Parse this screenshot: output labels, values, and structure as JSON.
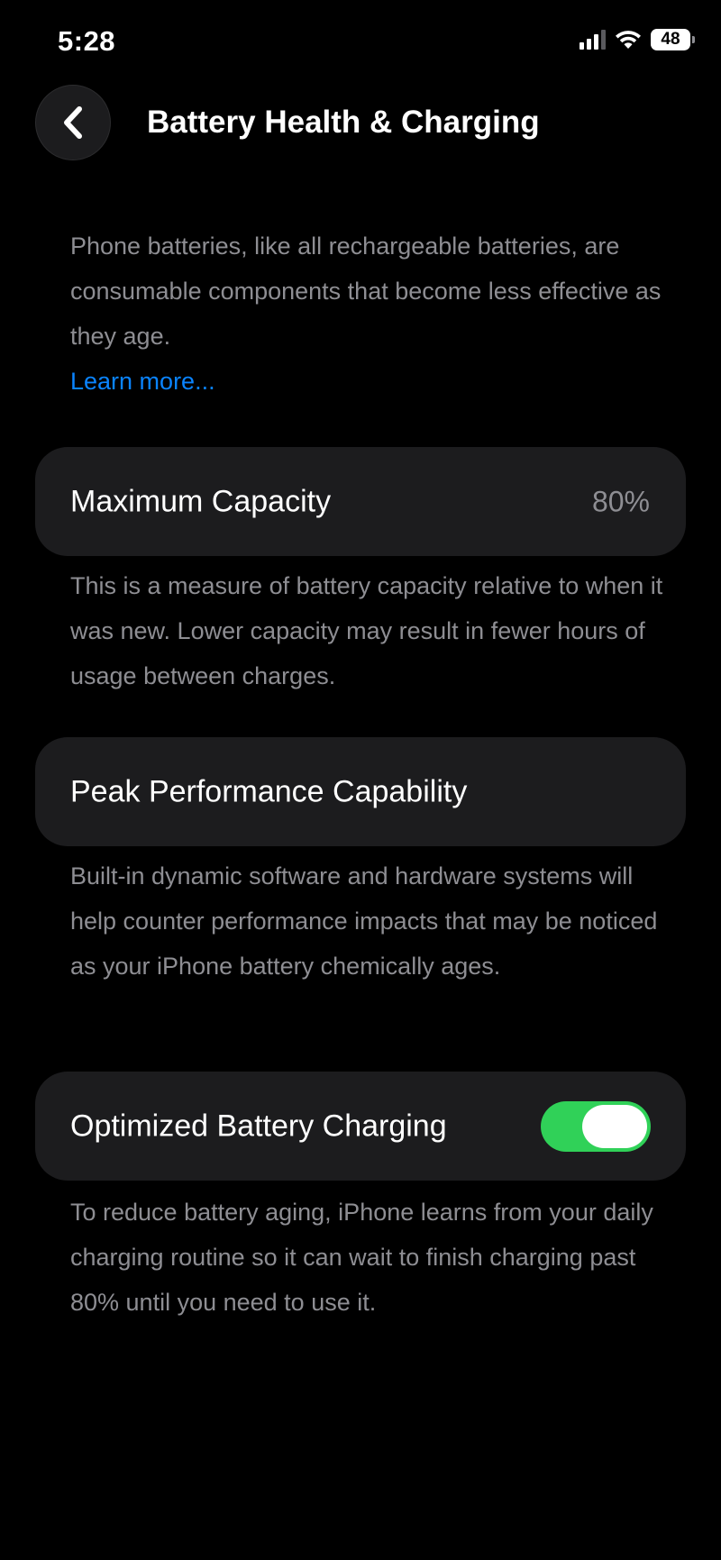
{
  "status_bar": {
    "time": "5:28",
    "battery_level": "48",
    "signal_bars_active": 3,
    "signal_bars_total": 4
  },
  "nav": {
    "back_icon": "chevron-left-icon",
    "title": "Battery Health & Charging"
  },
  "intro": {
    "text": "Phone batteries, like all rechargeable batteries, are consumable components that become less effective as they age.",
    "learn_more": "Learn more..."
  },
  "maximum_capacity": {
    "label": "Maximum Capacity",
    "value": "80%",
    "description": "This is a measure of battery capacity relative to when it was new. Lower capacity may result in fewer hours of usage between charges."
  },
  "peak_performance": {
    "label": "Peak Performance Capability",
    "description": "Built-in dynamic software and hardware systems will help counter performance impacts that may be noticed as your iPhone battery chemically ages."
  },
  "optimized_charging": {
    "label": "Optimized Battery Charging",
    "enabled": true,
    "description": "To reduce battery aging, iPhone learns from your daily charging routine so it can wait to finish charging past 80% until you need to use it."
  },
  "colors": {
    "background": "#000000",
    "card": "#1c1c1e",
    "secondary_text": "#8e8e93",
    "link": "#0a84ff",
    "toggle_on": "#30d158"
  }
}
